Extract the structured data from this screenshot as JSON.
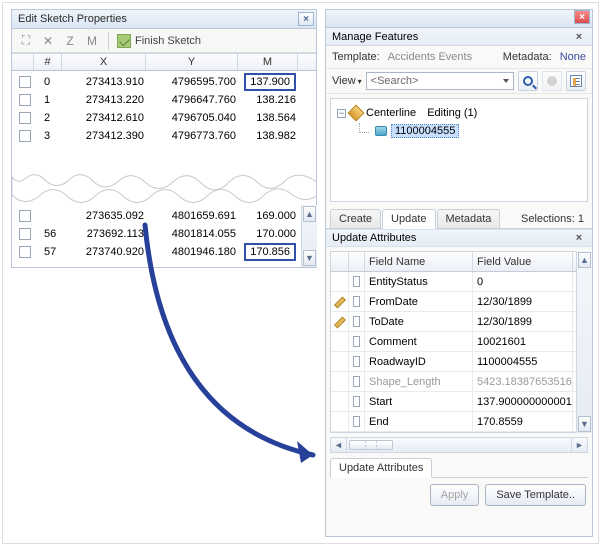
{
  "left": {
    "title": "Edit Sketch Properties",
    "toolbar": {
      "z": "Z",
      "m": "M",
      "finish": "Finish Sketch"
    },
    "columns": {
      "num": "#",
      "x": "X",
      "y": "Y",
      "m": "M"
    },
    "rows_top": [
      {
        "n": "0",
        "x": "273413.910",
        "y": "4796595.700",
        "m": "137.900",
        "hl": true
      },
      {
        "n": "1",
        "x": "273413.220",
        "y": "4796647.760",
        "m": "138.216"
      },
      {
        "n": "2",
        "x": "273412.610",
        "y": "4796705.040",
        "m": "138.564"
      },
      {
        "n": "3",
        "x": "273412.390",
        "y": "4796773.760",
        "m": "138.982"
      }
    ],
    "rows_bottom": [
      {
        "n": "",
        "x": "273635.092",
        "y": "4801659.691",
        "m": "169.000"
      },
      {
        "n": "56",
        "x": "273692.113",
        "y": "4801814.055",
        "m": "170.000"
      },
      {
        "n": "57",
        "x": "273740.920",
        "y": "4801946.180",
        "m": "170.856",
        "hl": true
      }
    ]
  },
  "right": {
    "manage_title": "Manage Features",
    "template": {
      "label": "Template:",
      "value": "Accidents Events",
      "meta_label": "Metadata:",
      "meta_value": "None"
    },
    "view": "View",
    "search_placeholder": "<Search>",
    "tree": {
      "layer": "Centerline",
      "editing": "Editing (1)",
      "feature_id": "1100004555"
    },
    "tabs": {
      "create": "Create",
      "update": "Update",
      "metadata": "Metadata"
    },
    "selections": "Selections: 1",
    "update_attr_title": "Update Attributes",
    "attr_headers": {
      "name": "Field Name",
      "value": "Field Value"
    },
    "attrs": [
      {
        "name": "EntityStatus",
        "value": "0"
      },
      {
        "name": "FromDate",
        "value": "12/30/1899",
        "pencil": true
      },
      {
        "name": "ToDate",
        "value": "12/30/1899",
        "pencil": true
      },
      {
        "name": "Comment",
        "value": "10021601"
      },
      {
        "name": "RoadwayID",
        "value": "1100004555"
      },
      {
        "name": "Shape_Length",
        "value": "5423.18387653516",
        "grey": true
      },
      {
        "name": "Start",
        "value": "137.900000000001"
      },
      {
        "name": "End",
        "value": "170.8559"
      }
    ],
    "bottom_tab": "Update Attributes",
    "buttons": {
      "apply": "Apply",
      "save": "Save Template.."
    }
  }
}
